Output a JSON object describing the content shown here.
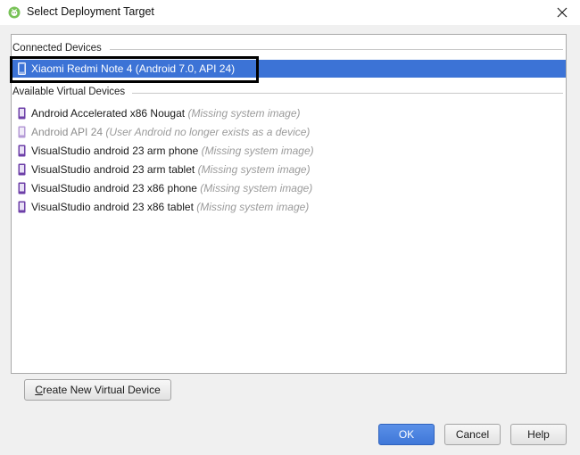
{
  "window": {
    "title": "Select Deployment Target",
    "close_symbol": "✕"
  },
  "groups": {
    "connected": {
      "label": "Connected Devices"
    },
    "virtual": {
      "label": "Available Virtual Devices"
    }
  },
  "connected_devices": [
    {
      "name": "Xiaomi Redmi Note 4 (Android 7.0, API 24)",
      "note": "",
      "selected": true
    }
  ],
  "virtual_devices": [
    {
      "name": "Android Accelerated x86 Nougat",
      "note": "(Missing system image)",
      "available": true
    },
    {
      "name": "Android API 24",
      "note": "(User Android no longer exists as a device)",
      "available": false
    },
    {
      "name": "VisualStudio android 23 arm phone",
      "note": "(Missing system image)",
      "available": true
    },
    {
      "name": "VisualStudio android 23 arm tablet",
      "note": "(Missing system image)",
      "available": true
    },
    {
      "name": "VisualStudio android 23 x86 phone",
      "note": "(Missing system image)",
      "available": true
    },
    {
      "name": "VisualStudio android 23 x86 tablet",
      "note": "(Missing system image)",
      "available": true
    }
  ],
  "buttons": {
    "create_new_mnemonic": "C",
    "create_new_rest": "reate New Virtual Device",
    "ok": "OK",
    "cancel": "Cancel",
    "help": "Help"
  },
  "colors": {
    "selection": "#3c73d6",
    "device_icon": "#6d3fa8",
    "app_icon": "#78c257"
  },
  "icons": {
    "app": "android-studio-icon",
    "device": "phone-icon",
    "close": "close-icon"
  }
}
